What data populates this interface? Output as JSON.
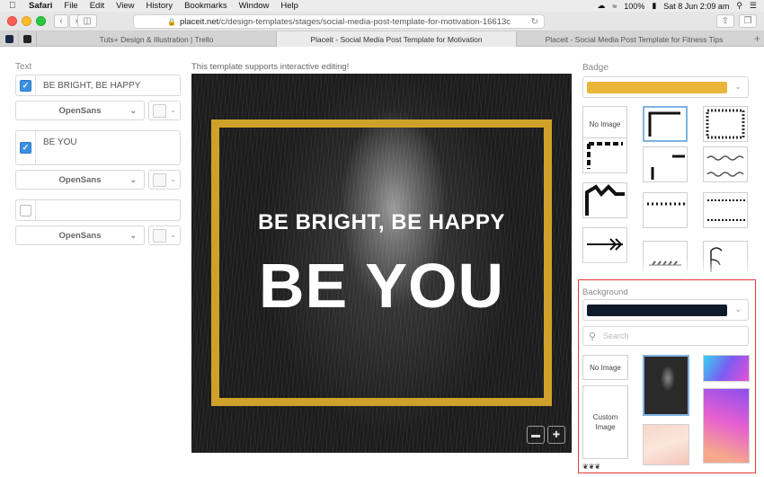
{
  "menubar": {
    "app": "Safari",
    "items": [
      "File",
      "Edit",
      "View",
      "History",
      "Bookmarks",
      "Window",
      "Help"
    ],
    "battery": "100%",
    "clock": "Sat 8 Jun 2:09 am"
  },
  "toolbar": {
    "url_domain": "placeit.net",
    "url_path": "/c/design-templates/stages/social-media-post-template-for-motivation-16613c"
  },
  "tabs": [
    {
      "label": "Tuts+ Design & Illustration | Trello",
      "active": false
    },
    {
      "label": "Placeit - Social Media Post Template for Motivation",
      "active": true
    },
    {
      "label": "Placeit - Social Media Post Template for Fitness Tips",
      "active": false
    }
  ],
  "text_panel": {
    "heading": "Text",
    "fields": [
      {
        "value": "BE BRIGHT, BE HAPPY",
        "checked": true,
        "font": "OpenSans"
      },
      {
        "value": "BE YOU",
        "checked": true,
        "font": "OpenSans"
      },
      {
        "value": "",
        "checked": false,
        "font": "OpenSans"
      }
    ]
  },
  "canvas": {
    "notice": "This template supports interactive editing!",
    "line1": "BE BRIGHT, BE HAPPY",
    "line2": "BE YOU",
    "frame_color": "#cfa12a"
  },
  "badge_panel": {
    "heading": "Badge",
    "color": "#eab63a",
    "no_image_label": "No Image"
  },
  "background_panel": {
    "heading": "Background",
    "color": "#0f1a2b",
    "search_placeholder": "Search",
    "no_image_label": "No Image",
    "custom_image_label": "Custom Image",
    "highlight_color": "#e8383a"
  }
}
